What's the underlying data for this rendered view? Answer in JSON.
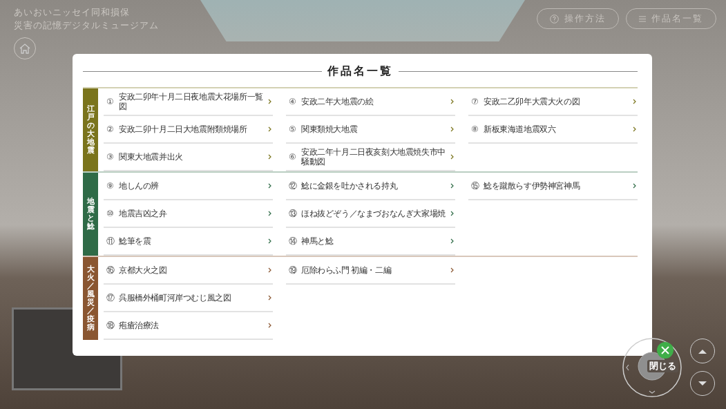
{
  "site": {
    "title_line_1": "あいおいニッセイ同和損保",
    "title_line_2": "災害の記憶デジタルミュージアム"
  },
  "header_buttons": [
    {
      "kind": "help",
      "label": "操作方法"
    },
    {
      "kind": "list",
      "label": "作品名一覧"
    }
  ],
  "modal": {
    "title": "作品名一覧",
    "close_label": "閉じる",
    "sections": [
      {
        "label": "江戸の大地震",
        "color": "#7a741c",
        "columns": [
          [
            {
              "number": "①",
              "title": "安政二卯年十月二日夜地震大花場所一覧図"
            },
            {
              "number": "②",
              "title": "安政二卯十月二日大地震附類焼場所"
            },
            {
              "number": "③",
              "title": "関東大地震并出火"
            }
          ],
          [
            {
              "number": "④",
              "title": "安政二年大地震の絵"
            },
            {
              "number": "⑤",
              "title": "関東類焼大地震"
            },
            {
              "number": "⑥",
              "title": "安政二年十月二日夜亥刻大地震焼失市中騒動図"
            }
          ],
          [
            {
              "number": "⑦",
              "title": "安政二乙卯年大震大火の図"
            },
            {
              "number": "⑧",
              "title": "新板東海道地震双六"
            }
          ]
        ]
      },
      {
        "label": "地震と鯰",
        "color": "#2f6b47",
        "columns": [
          [
            {
              "number": "⑨",
              "title": "地しんの辨"
            },
            {
              "number": "⑩",
              "title": "地震吉凶之弁"
            },
            {
              "number": "⑪",
              "title": "鯰筆を震"
            }
          ],
          [
            {
              "number": "⑫",
              "title": "鯰に金銀を吐かされる持丸"
            },
            {
              "number": "⑬",
              "title": "ほね抜どぞう／なまづおなんぎ大家場焼"
            },
            {
              "number": "⑭",
              "title": "神馬と鯰"
            }
          ],
          [
            {
              "number": "⑮",
              "title": "鯰を蹴散らす伊勢神宮神馬"
            }
          ]
        ]
      },
      {
        "label": "大火／風災／疫病",
        "color": "#8a5631",
        "columns": [
          [
            {
              "number": "⑯",
              "title": "京都大火之図"
            },
            {
              "number": "⑰",
              "title": "呉服橋外桶町河岸つむじ風之図"
            },
            {
              "number": "⑱",
              "title": "疱瘡治療法"
            }
          ],
          [
            {
              "number": "⑲",
              "title": "厄除わらふ門 初編・二編"
            }
          ],
          []
        ]
      }
    ]
  }
}
